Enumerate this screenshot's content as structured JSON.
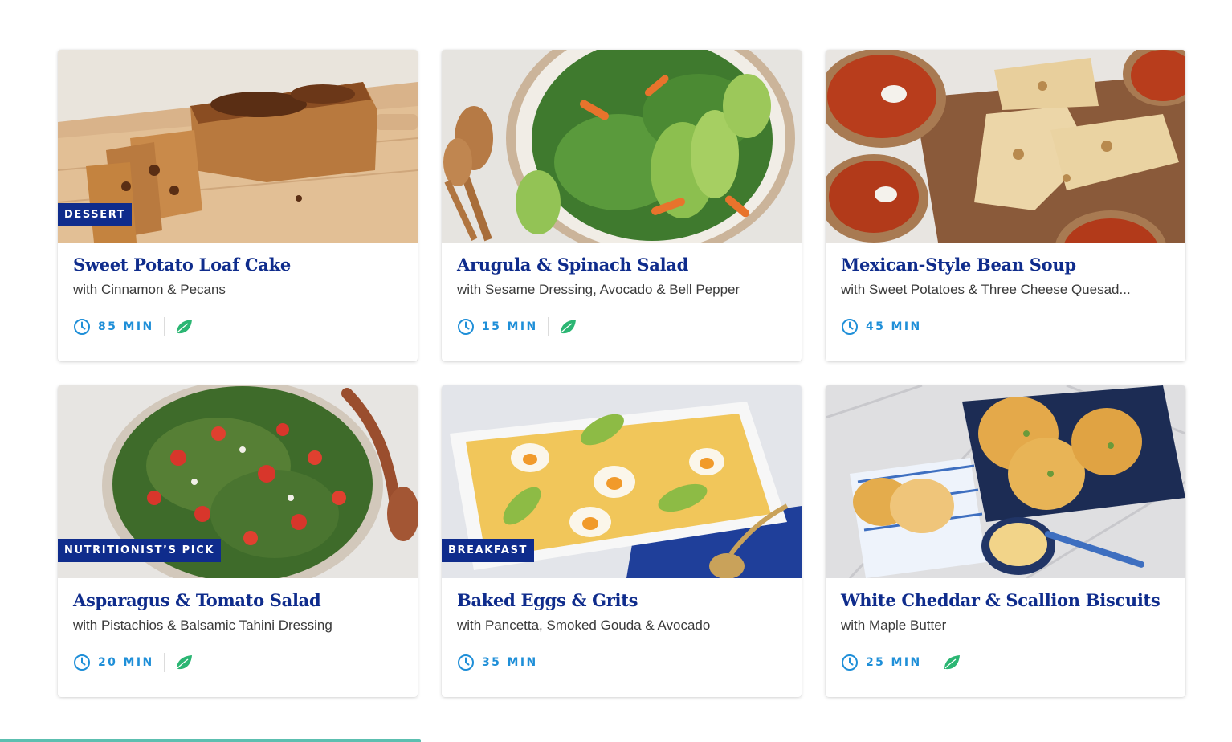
{
  "colors": {
    "title_blue": "#0f2c8c",
    "badge_bg": "#0f2c8c",
    "time_blue": "#1f8fd8",
    "leaf_green": "#2bb673",
    "accent_teal": "#5cbfb0"
  },
  "cards": [
    {
      "badge": "DESSERT",
      "title": "Sweet Potato Loaf Cake",
      "subtitle": "with Cinnamon & Pecans",
      "time": "85 MIN",
      "vegetarian": true,
      "image_icon": "sweet-potato-loaf-image"
    },
    {
      "badge": "",
      "title": "Arugula & Spinach Salad",
      "subtitle": "with Sesame Dressing, Avocado & Bell Pepper",
      "time": "15 MIN",
      "vegetarian": true,
      "image_icon": "arugula-salad-image"
    },
    {
      "badge": "",
      "title": "Mexican-Style Bean Soup",
      "subtitle": "with Sweet Potatoes & Three Cheese Quesad...",
      "time": "45 MIN",
      "vegetarian": false,
      "image_icon": "bean-soup-image"
    },
    {
      "badge": "NUTRITIONIST’S PICK",
      "title": "Asparagus & Tomato Salad",
      "subtitle": "with Pistachios & Balsamic Tahini Dressing",
      "time": "20 MIN",
      "vegetarian": true,
      "image_icon": "asparagus-salad-image"
    },
    {
      "badge": "BREAKFAST",
      "title": "Baked Eggs & Grits",
      "subtitle": "with Pancetta, Smoked Gouda & Avocado",
      "time": "35 MIN",
      "vegetarian": false,
      "image_icon": "baked-eggs-image"
    },
    {
      "badge": "",
      "title": "White Cheddar & Scallion Biscuits",
      "subtitle": "with Maple Butter",
      "time": "25 MIN",
      "vegetarian": true,
      "image_icon": "biscuits-image"
    }
  ]
}
